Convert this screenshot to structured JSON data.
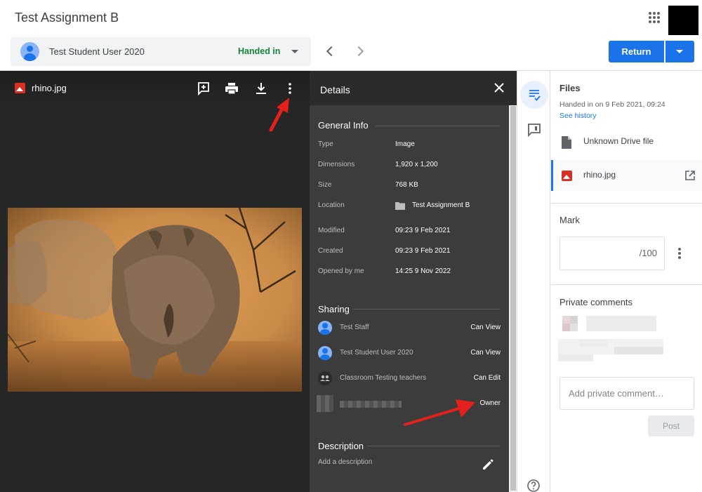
{
  "header": {
    "title": "Test Assignment B",
    "student_name": "Test Student User 2020",
    "student_status": "Handed in",
    "return_label": "Return"
  },
  "viewer": {
    "file_name": "rhino.jpg"
  },
  "details": {
    "title": "Details",
    "general_info_title": "General Info",
    "general_info": [
      {
        "label": "Type",
        "value": "Image"
      },
      {
        "label": "Dimensions",
        "value": "1,920 x 1,200"
      },
      {
        "label": "Size",
        "value": "768 KB"
      },
      {
        "label": "Location",
        "value": "Test Assignment B"
      },
      {
        "label": "Modified",
        "value": "09:23 9 Feb 2021"
      },
      {
        "label": "Created",
        "value": "09:23 9 Feb 2021"
      },
      {
        "label": "Opened by me",
        "value": "14:25 9 Nov 2022"
      }
    ],
    "sharing_title": "Sharing",
    "sharing": [
      {
        "name": "Test Staff",
        "permission": "Can View"
      },
      {
        "name": "Test Student User 2020",
        "permission": "Can View"
      },
      {
        "name": "Classroom Testing teachers",
        "permission": "Can Edit"
      },
      {
        "name": "",
        "permission": "Owner"
      }
    ],
    "description_title": "Description",
    "description_placeholder": "Add a description"
  },
  "panel": {
    "files_title": "Files",
    "handed_in_date": "Handed in on 9 Feb 2021, 09:24",
    "see_history": "See history",
    "files": [
      {
        "name": "Unknown Drive file"
      },
      {
        "name": "rhino.jpg"
      }
    ],
    "mark_title": "Mark",
    "mark_denominator": "/100",
    "private_comments_title": "Private comments",
    "comment_placeholder": "Add private comment…",
    "post_label": "Post"
  },
  "colors": {
    "accent": "#1a73e8",
    "handed_in": "#188038",
    "image_file": "#d93025"
  }
}
